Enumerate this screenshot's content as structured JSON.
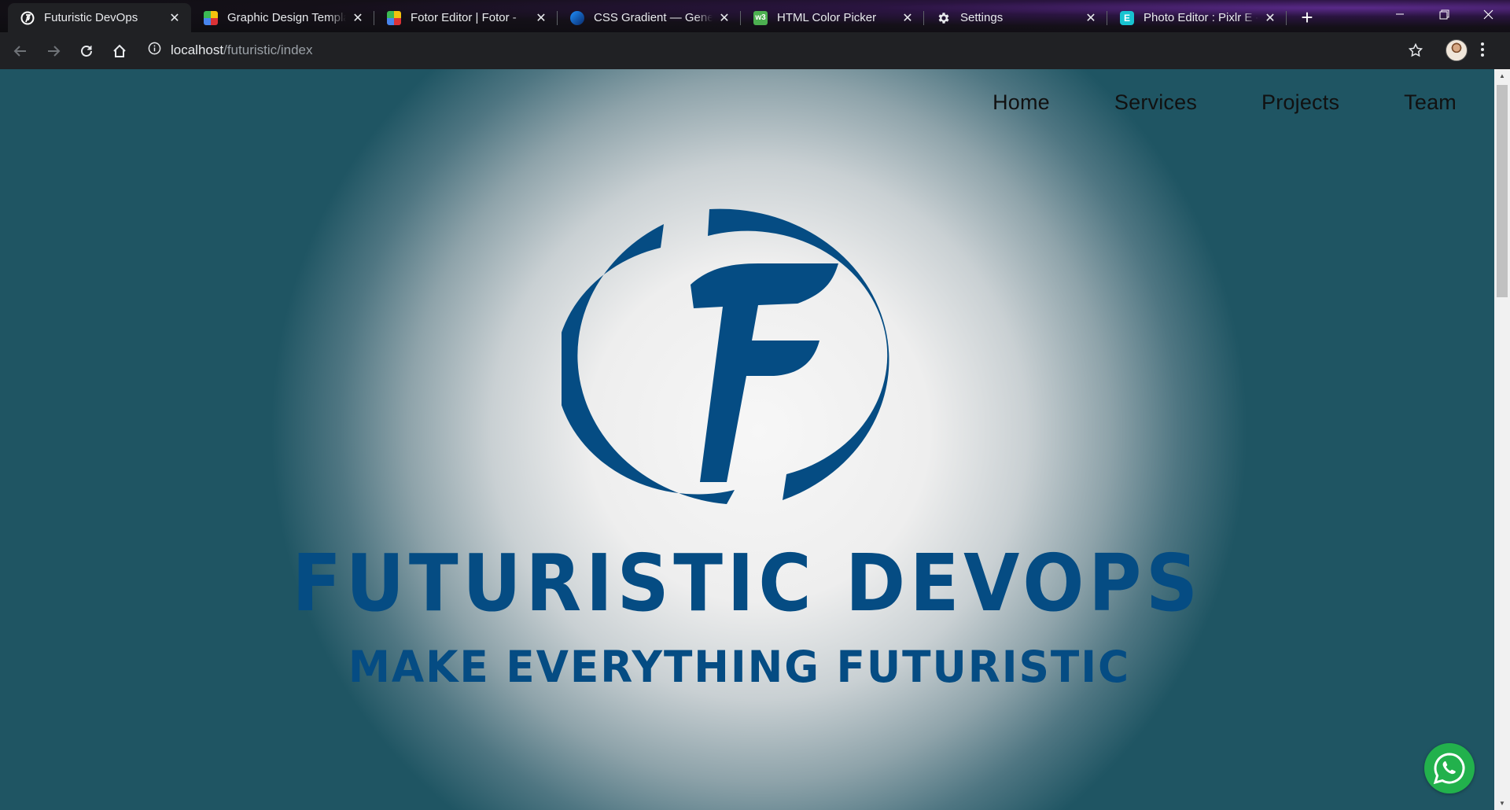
{
  "browser": {
    "tabs": [
      {
        "title": "Futuristic DevOps",
        "favicon": "futuristic-favicon-icon",
        "active": true
      },
      {
        "title": "Graphic Design Templa",
        "favicon": "fotor-favicon-icon"
      },
      {
        "title": "Fotor Editor | Fotor -",
        "favicon": "fotor-favicon-icon"
      },
      {
        "title": "CSS Gradient — Gener",
        "favicon": "cssgradient-favicon-icon"
      },
      {
        "title": "HTML Color Picker",
        "favicon": "w3schools-favicon-icon"
      },
      {
        "title": "Settings",
        "favicon": "gear-icon"
      },
      {
        "title": "Photo Editor : Pixlr E -",
        "favicon": "pixlr-favicon-icon"
      }
    ],
    "address": {
      "host": "localhost",
      "path": "/futuristic/index"
    }
  },
  "page": {
    "nav": [
      "Home",
      "Services",
      "Projects",
      "Team"
    ],
    "brand_title": "FUTURISTIC DEVOPS",
    "brand_tagline": "MAKE EVERYTHING FUTURISTIC"
  },
  "colors": {
    "brand_blue": "#054c83",
    "whatsapp_green": "#22b14c",
    "tab_active": "#202124"
  }
}
